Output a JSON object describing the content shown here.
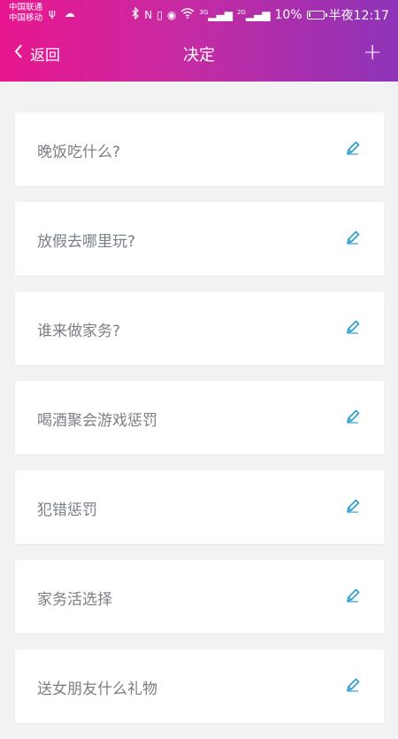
{
  "status_bar": {
    "carrier_1": "中国联通",
    "carrier_2": "中国移动",
    "left_icons": "ψ ☁",
    "signal_3g": "3G",
    "signal_2g": "2G",
    "battery_percent": "10%",
    "battery_level": 0.1,
    "time": "半夜12:17"
  },
  "navbar": {
    "back_label": "返回",
    "title": "决定",
    "add_symbol": "+"
  },
  "decisions": [
    {
      "label": "晚饭吃什么?"
    },
    {
      "label": "放假去哪里玩?"
    },
    {
      "label": "谁来做家务?"
    },
    {
      "label": "喝酒聚会游戏惩罚"
    },
    {
      "label": "犯错惩罚"
    },
    {
      "label": "家务活选择"
    },
    {
      "label": "送女朋友什么礼物"
    }
  ],
  "colors": {
    "gradient_start": "#e8168f",
    "gradient_end": "#8e34b8",
    "edit_icon": "#2a9fd0",
    "item_text": "#7a7f86",
    "background": "#f2f2f5"
  },
  "icons": {
    "back": "chevron-left-icon",
    "add": "plus-icon",
    "edit": "pencil-icon"
  }
}
